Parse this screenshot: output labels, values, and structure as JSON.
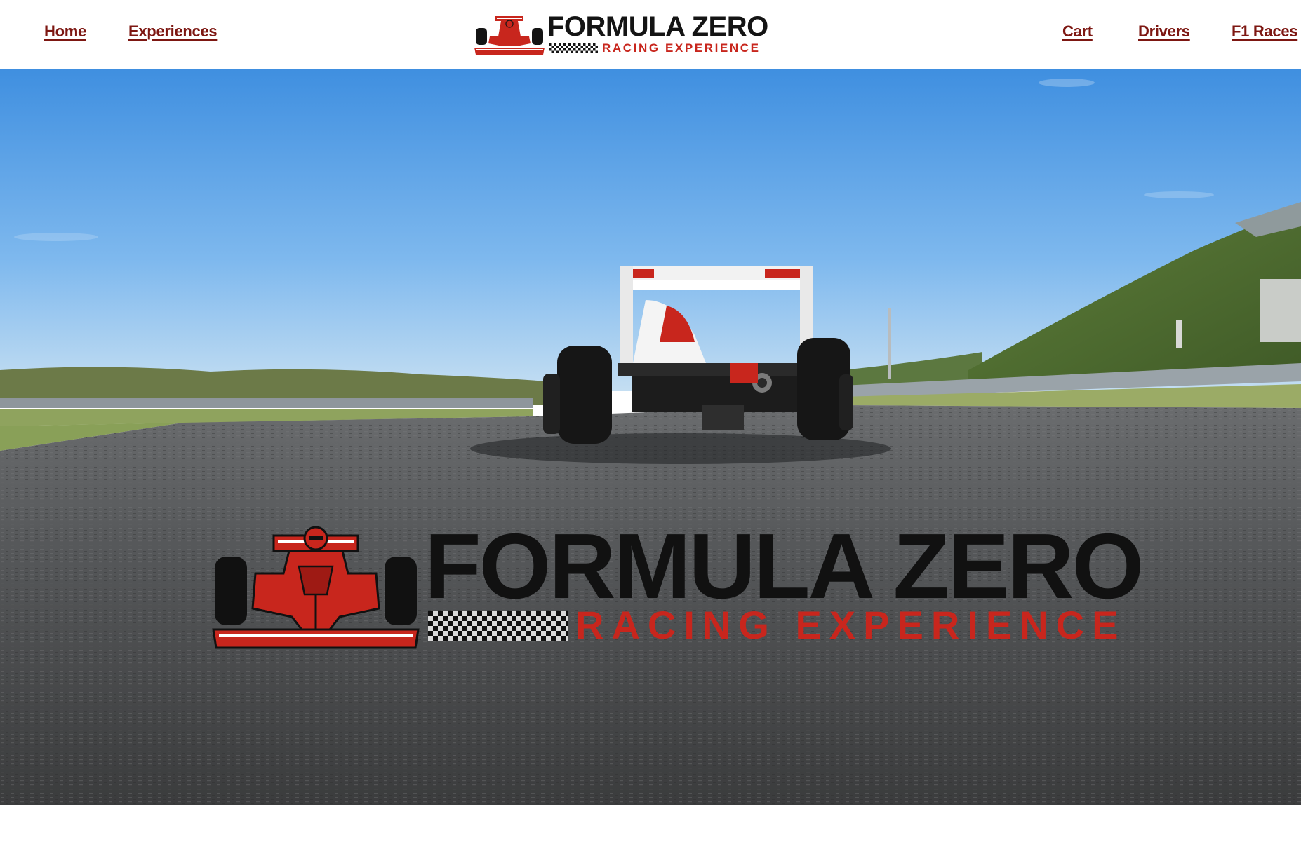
{
  "nav": {
    "left": [
      {
        "label": "Home"
      },
      {
        "label": "Experiences"
      }
    ],
    "right": [
      {
        "label": "Cart"
      },
      {
        "label": "Drivers"
      },
      {
        "label": "F1 Races"
      }
    ]
  },
  "brand": {
    "title": "FORMULA ZERO",
    "subtitle": "RACING EXPERIENCE",
    "logo_icon": "formula-car-icon"
  },
  "hero": {
    "background": "formula-car-on-race-track-photo",
    "logo_title": "FORMULA ZERO",
    "logo_subtitle": "RACING EXPERIENCE"
  },
  "colors": {
    "brand_red": "#c8261d",
    "nav_link": "#7d1712",
    "logo_black": "#111111"
  }
}
